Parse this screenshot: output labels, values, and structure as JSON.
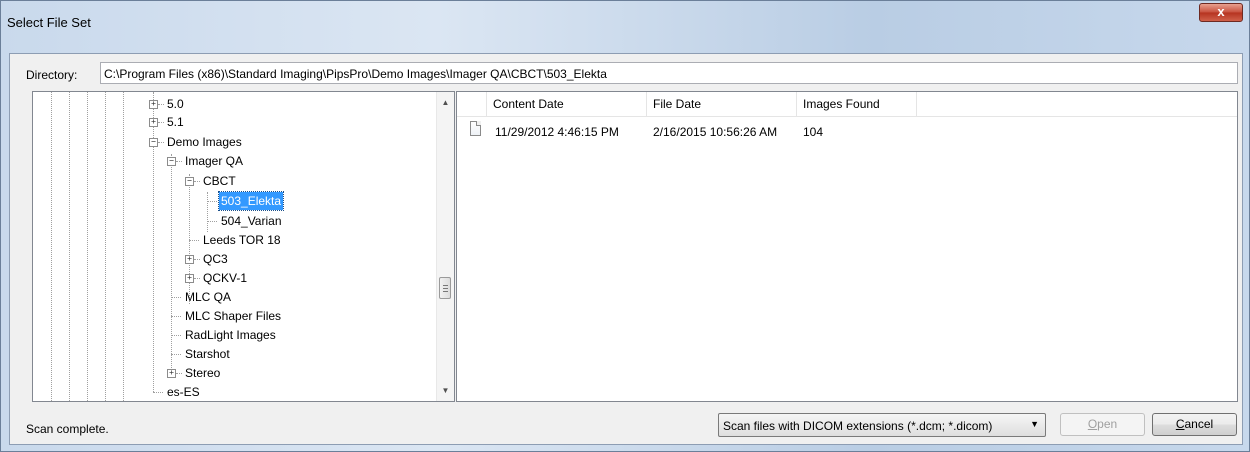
{
  "window": {
    "title": "Select File Set",
    "close_label": "x"
  },
  "directory": {
    "label": "Directory:",
    "value": "C:\\Program Files (x86)\\Standard Imaging\\PipsPro\\Demo Images\\Imager QA\\CBCT\\503_Elekta"
  },
  "tree": {
    "items": [
      {
        "label": "5.0",
        "expander": "+"
      },
      {
        "label": "5.1",
        "expander": "+"
      },
      {
        "label": "Demo Images",
        "expander": "−"
      },
      {
        "label": "Imager QA",
        "expander": "−"
      },
      {
        "label": "CBCT",
        "expander": "−"
      },
      {
        "label": "503_Elekta",
        "selected": true
      },
      {
        "label": "504_Varian"
      },
      {
        "label": "Leeds TOR 18"
      },
      {
        "label": "QC3",
        "expander": "+"
      },
      {
        "label": "QCKV-1",
        "expander": "+"
      },
      {
        "label": "MLC QA"
      },
      {
        "label": "MLC Shaper Files"
      },
      {
        "label": "RadLight Images"
      },
      {
        "label": "Starshot"
      },
      {
        "label": "Stereo",
        "expander": "+"
      },
      {
        "label": "es-ES"
      }
    ]
  },
  "list": {
    "columns": [
      "Content Date",
      "File Date",
      "Images Found"
    ],
    "rows": [
      {
        "icon": "file-icon",
        "content_date": "11/29/2012 4:46:15 PM",
        "file_date": "2/16/2015 10:56:26 AM",
        "images_found": "104"
      }
    ]
  },
  "status": "Scan complete.",
  "scan_mode": {
    "selected": "Scan files with DICOM extensions (*.dcm; *.dicom)"
  },
  "buttons": {
    "open": {
      "mnemonic": "O",
      "rest": "pen",
      "enabled": false
    },
    "cancel": {
      "mnemonic": "C",
      "rest": "ancel",
      "enabled": true
    }
  }
}
